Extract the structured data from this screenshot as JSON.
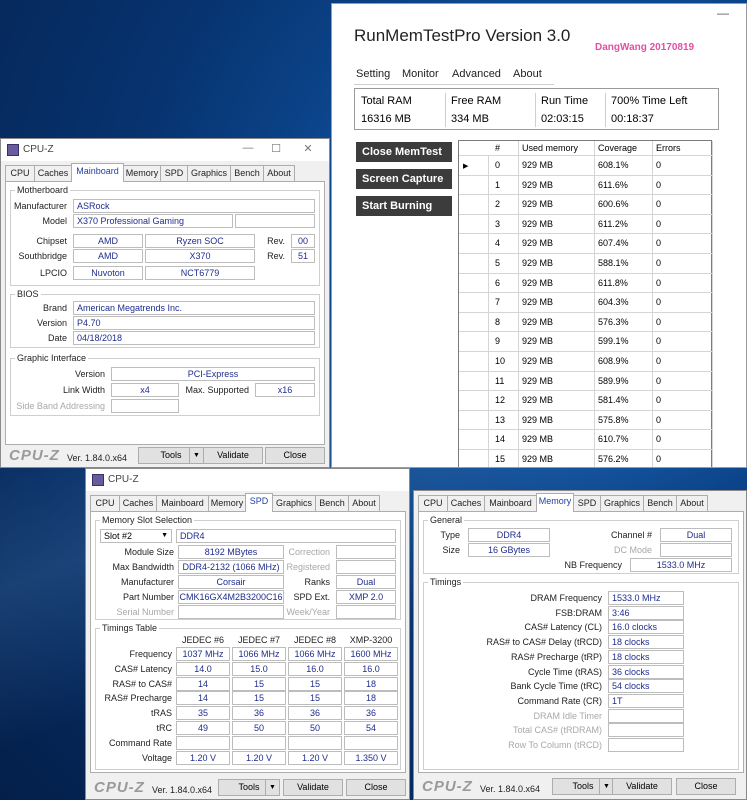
{
  "runmem": {
    "title": "RunMemTestPro Version 3.0",
    "author": "DangWang  20170819",
    "menu": [
      "Setting",
      "Monitor",
      "Advanced",
      "About"
    ],
    "stats_headers": [
      "Total RAM",
      "Free RAM",
      "Run Time",
      "700% Time Left"
    ],
    "stats_values": [
      "16316 MB",
      "334 MB",
      "02:03:15",
      "00:18:37"
    ],
    "buttons": [
      "Close MemTest",
      "Screen Capture",
      "Start Burning"
    ],
    "columns": [
      "#",
      "Used memory",
      "Coverage",
      "Errors"
    ],
    "rows": [
      [
        "0",
        "929 MB",
        "608.1%",
        "0"
      ],
      [
        "1",
        "929 MB",
        "611.6%",
        "0"
      ],
      [
        "2",
        "929 MB",
        "600.6%",
        "0"
      ],
      [
        "3",
        "929 MB",
        "611.2%",
        "0"
      ],
      [
        "4",
        "929 MB",
        "607.4%",
        "0"
      ],
      [
        "5",
        "929 MB",
        "588.1%",
        "0"
      ],
      [
        "6",
        "929 MB",
        "611.8%",
        "0"
      ],
      [
        "7",
        "929 MB",
        "604.3%",
        "0"
      ],
      [
        "8",
        "929 MB",
        "576.3%",
        "0"
      ],
      [
        "9",
        "929 MB",
        "599.1%",
        "0"
      ],
      [
        "10",
        "929 MB",
        "608.9%",
        "0"
      ],
      [
        "11",
        "929 MB",
        "589.9%",
        "0"
      ],
      [
        "12",
        "929 MB",
        "581.4%",
        "0"
      ],
      [
        "13",
        "929 MB",
        "575.8%",
        "0"
      ],
      [
        "14",
        "929 MB",
        "610.7%",
        "0"
      ],
      [
        "15",
        "929 MB",
        "576.2%",
        "0"
      ]
    ]
  },
  "cpuz_common": {
    "title": "CPU-Z",
    "logo": "CPU-Z",
    "version": "Ver. 1.84.0.x64",
    "tools": "Tools",
    "validate": "Validate",
    "close": "Close",
    "tabs": [
      "CPU",
      "Caches",
      "Mainboard",
      "Memory",
      "SPD",
      "Graphics",
      "Bench",
      "About"
    ]
  },
  "mainboard": {
    "motherboard_title": "Motherboard",
    "manufacturer_label": "Manufacturer",
    "manufacturer": "ASRock",
    "model_label": "Model",
    "model": "X370 Professional Gaming",
    "chipset_label": "Chipset",
    "chipset_vendor": "AMD",
    "chipset_name": "Ryzen SOC",
    "rev_label": "Rev.",
    "chipset_rev": "00",
    "southbridge_label": "Southbridge",
    "sb_vendor": "AMD",
    "sb_name": "X370",
    "sb_rev": "51",
    "lpcio_label": "LPCIO",
    "lpcio_vendor": "Nuvoton",
    "lpcio_name": "NCT6779",
    "bios_title": "BIOS",
    "brand_label": "Brand",
    "brand": "American Megatrends Inc.",
    "version_label": "Version",
    "version": "P4.70",
    "date_label": "Date",
    "date": "04/18/2018",
    "gi_title": "Graphic Interface",
    "gi_version_label": "Version",
    "gi_version": "PCI-Express",
    "link_width_label": "Link Width",
    "link_width": "x4",
    "max_supported_label": "Max. Supported",
    "max_supported": "x16",
    "side_band_label": "Side Band Addressing"
  },
  "spd": {
    "slot_title": "Memory Slot Selection",
    "slot": "Slot #2",
    "type": "DDR4",
    "module_size_label": "Module Size",
    "module_size": "8192 MBytes",
    "max_bw_label": "Max Bandwidth",
    "max_bw": "DDR4-2132 (1066 MHz)",
    "manufacturer_label": "Manufacturer",
    "manufacturer": "Corsair",
    "part_label": "Part Number",
    "part": "CMK16GX4M2B3200C16",
    "serial_label": "Serial Number",
    "correction_label": "Correction",
    "registered_label": "Registered",
    "ranks_label": "Ranks",
    "ranks": "Dual",
    "spd_ext_label": "SPD Ext.",
    "spd_ext": "XMP 2.0",
    "week_label": "Week/Year",
    "timings_title": "Timings Table",
    "timing_cols": [
      "JEDEC #6",
      "JEDEC #7",
      "JEDEC #8",
      "XMP-3200"
    ],
    "timing_rows": [
      {
        "label": "Frequency",
        "values": [
          "1037 MHz",
          "1066 MHz",
          "1066 MHz",
          "1600 MHz"
        ]
      },
      {
        "label": "CAS# Latency",
        "values": [
          "14.0",
          "15.0",
          "16.0",
          "16.0"
        ]
      },
      {
        "label": "RAS# to CAS#",
        "values": [
          "14",
          "15",
          "15",
          "18"
        ]
      },
      {
        "label": "RAS# Precharge",
        "values": [
          "14",
          "15",
          "15",
          "18"
        ]
      },
      {
        "label": "tRAS",
        "values": [
          "35",
          "36",
          "36",
          "36"
        ]
      },
      {
        "label": "tRC",
        "values": [
          "49",
          "50",
          "50",
          "54"
        ]
      },
      {
        "label": "Command Rate",
        "values": [
          "",
          "",
          "",
          ""
        ]
      },
      {
        "label": "Voltage",
        "values": [
          "1.20 V",
          "1.20 V",
          "1.20 V",
          "1.350 V"
        ]
      }
    ]
  },
  "memory": {
    "general_title": "General",
    "type_label": "Type",
    "type": "DDR4",
    "size_label": "Size",
    "size": "16 GBytes",
    "channel_label": "Channel #",
    "channel": "Dual",
    "dc_mode_label": "DC Mode",
    "nb_freq_label": "NB Frequency",
    "nb_freq": "1533.0 MHz",
    "timings_title": "Timings",
    "timings": [
      {
        "label": "DRAM Frequency",
        "value": "1533.0 MHz",
        "dim": false
      },
      {
        "label": "FSB:DRAM",
        "value": "3:46",
        "dim": false
      },
      {
        "label": "CAS# Latency (CL)",
        "value": "16.0 clocks",
        "dim": false
      },
      {
        "label": "RAS# to CAS# Delay (tRCD)",
        "value": "18 clocks",
        "dim": false
      },
      {
        "label": "RAS# Precharge (tRP)",
        "value": "18 clocks",
        "dim": false
      },
      {
        "label": "Cycle Time (tRAS)",
        "value": "36 clocks",
        "dim": false
      },
      {
        "label": "Bank Cycle Time (tRC)",
        "value": "54 clocks",
        "dim": false
      },
      {
        "label": "Command Rate (CR)",
        "value": "1T",
        "dim": false
      },
      {
        "label": "DRAM Idle Timer",
        "value": "",
        "dim": true
      },
      {
        "label": "Total CAS# (tRDRAM)",
        "value": "",
        "dim": true
      },
      {
        "label": "Row To Column (tRCD)",
        "value": "",
        "dim": true
      }
    ]
  }
}
